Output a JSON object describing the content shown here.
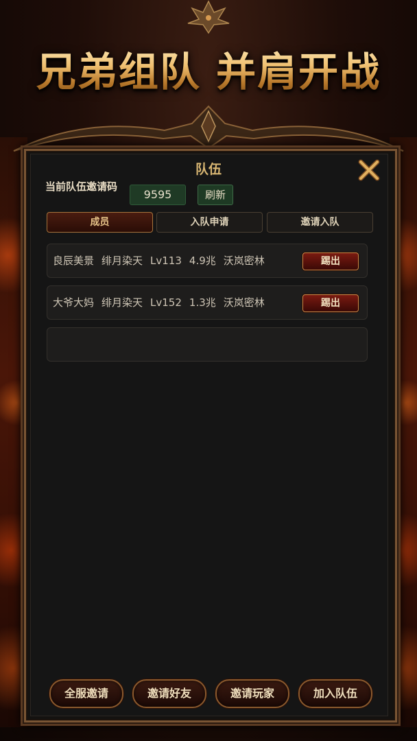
{
  "banner": {
    "text": "兄弟组队 并肩开战"
  },
  "dialog": {
    "title": "队伍",
    "close_icon": "close-x-icon"
  },
  "invite": {
    "label": "当前队伍邀请码",
    "code": "9595",
    "refresh_label": "刷新"
  },
  "tabs": [
    {
      "label": "成员",
      "active": true
    },
    {
      "label": "入队申请",
      "active": false
    },
    {
      "label": "邀请入队",
      "active": false
    }
  ],
  "members": [
    {
      "name": "良辰美景",
      "guild": "绯月染天",
      "level": "Lv113",
      "power": "4.9兆",
      "location": "沃岚密林",
      "kick_label": "踢出"
    },
    {
      "name": "大爷大妈",
      "guild": "绯月染天",
      "level": "Lv152",
      "power": "1.3兆",
      "location": "沃岚密林",
      "kick_label": "踢出"
    }
  ],
  "bottom_buttons": [
    {
      "label": "全服邀请"
    },
    {
      "label": "邀请好友"
    },
    {
      "label": "邀请玩家"
    },
    {
      "label": "加入队伍"
    }
  ],
  "colors": {
    "gold": "#d9b773",
    "panel": "#151515",
    "green": "#1f3a25",
    "kick_red": "#7a1a10"
  }
}
